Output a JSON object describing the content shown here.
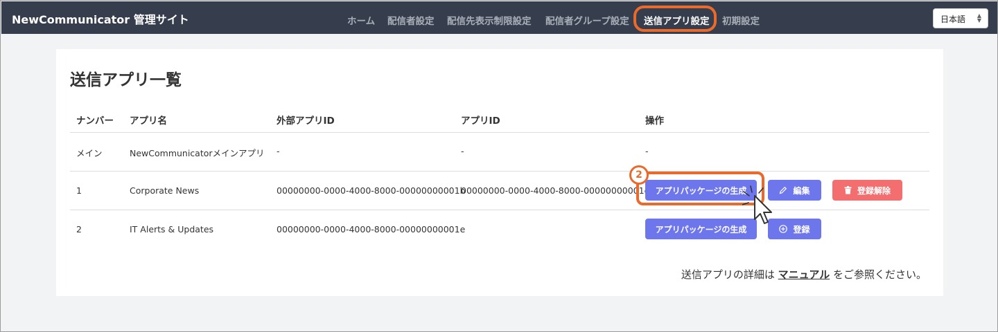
{
  "brand": "NewCommunicator 管理サイト",
  "nav": {
    "items": [
      "ホーム",
      "配信者設定",
      "配信先表示制限設定",
      "配信者グループ設定",
      "送信アプリ設定",
      "初期設定"
    ],
    "language": "日本語"
  },
  "page": {
    "title": "送信アプリ一覧",
    "columns": [
      "ナンバー",
      "アプリ名",
      "外部アプリID",
      "アプリID",
      "操作"
    ],
    "rows": [
      {
        "number": "メイン",
        "name": "NewCommunicatorメインアプリ",
        "external_id": "-",
        "app_id": "-",
        "action": "-"
      },
      {
        "number": "1",
        "name": "Corporate News",
        "external_id": "00000000-0000-4000-8000-00000000001b",
        "app_id": "00000000-0000-4000-8000-00000000001c",
        "buttons": {
          "generate": "アプリパッケージの生成",
          "edit": "編集",
          "unregister": "登録解除"
        }
      },
      {
        "number": "2",
        "name": "IT Alerts & Updates",
        "external_id": "00000000-0000-4000-8000-00000000001e",
        "app_id": "",
        "buttons": {
          "generate": "アプリパッケージの生成",
          "register": "登録"
        }
      }
    ]
  },
  "footnote": {
    "prefix": "送信アプリの詳細は ",
    "link": "マニュアル",
    "suffix": " をご参照ください。"
  },
  "annotation": {
    "step": "2"
  },
  "colors": {
    "navbar": "#363d4c",
    "primary": "#6e76ec",
    "danger": "#f36f6f",
    "highlight": "#ea6a2c"
  }
}
